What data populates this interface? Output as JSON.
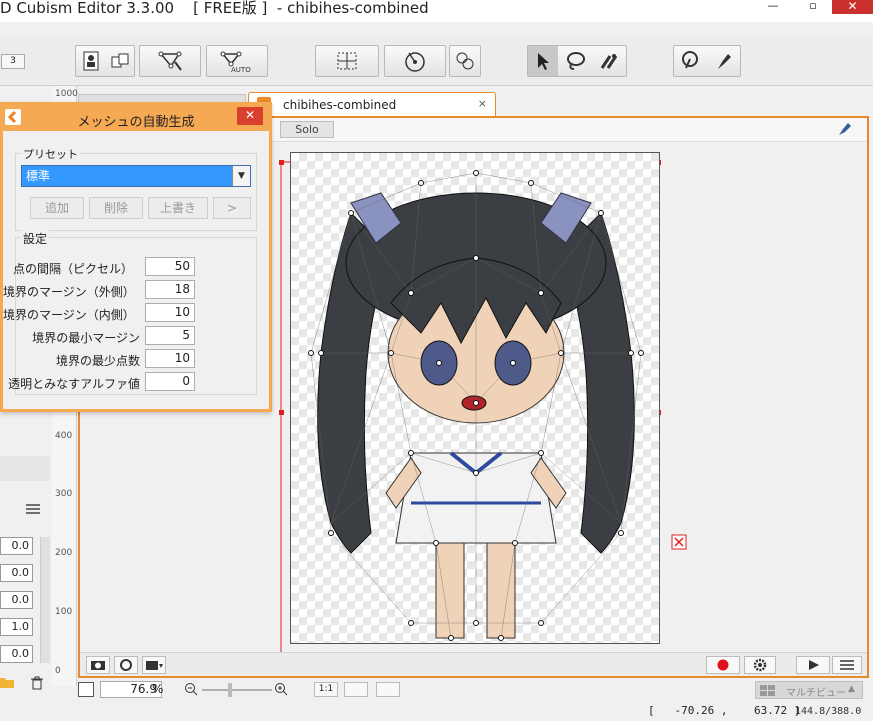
{
  "window": {
    "title": "D Cubism Editor 3.3.00    [ FREE版 ]  - chibihes-combined",
    "min": "—",
    "max": "▫",
    "close": "✕"
  },
  "toolbar": {
    "page_number": "3"
  },
  "ruler": {
    "labels": [
      "1000",
      "400",
      "300",
      "200",
      "100",
      "0"
    ]
  },
  "tabs": {
    "active": "chibihes-combined",
    "close": "×"
  },
  "view": {
    "solo": "Solo"
  },
  "params": {
    "values": [
      "0.0",
      "0.0",
      "0.0",
      "1.0",
      "0.0"
    ]
  },
  "zoom": {
    "value": "76.9",
    "unit": "%",
    "one_to_one": "1:1"
  },
  "status": {
    "coords": "[   -70.26 ,    63.72 ]",
    "size": "144.8/388.0"
  },
  "multiview": {
    "label": "マルチビュー"
  },
  "dialog": {
    "title": "メッシュの自動生成",
    "close": "✕",
    "preset_group": "プリセット",
    "preset_value": "標準",
    "buttons": {
      "add": "追加",
      "delete": "削除",
      "overwrite": "上書き",
      "more": ">"
    },
    "settings_group": "設定",
    "settings": [
      {
        "label": "点の間隔（ピクセル）",
        "value": "50"
      },
      {
        "label": "境界のマージン（外側）",
        "value": "18"
      },
      {
        "label": "境界のマージン（内側）",
        "value": "10"
      },
      {
        "label": "境界の最小マージン",
        "value": "5"
      },
      {
        "label": "境界の最少点数",
        "value": "10"
      },
      {
        "label": "透明とみなすアルファ値",
        "value": "0"
      }
    ]
  },
  "colors": {
    "accent": "#e38b2e",
    "dialog_frame": "#f5a952",
    "select_blue": "#3399ff",
    "record_red": "#e0101a"
  }
}
